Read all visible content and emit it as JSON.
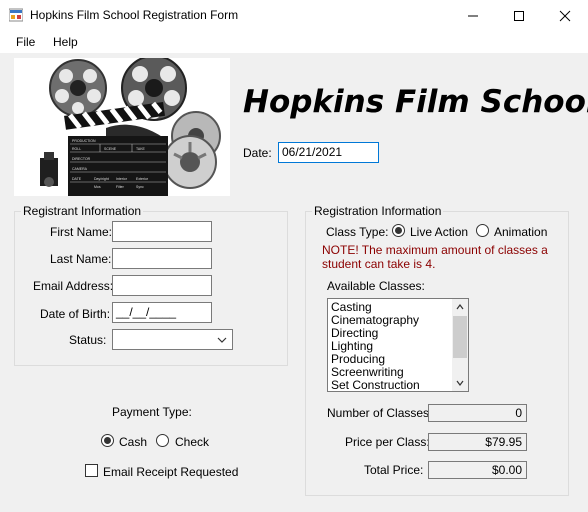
{
  "window": {
    "title": "Hopkins Film School Registration Form"
  },
  "menu": {
    "items": [
      "File",
      "Help"
    ]
  },
  "header": {
    "school_name": "Hopkins Film School",
    "date_label": "Date:",
    "date_value": "06/21/2021"
  },
  "registrant": {
    "group_title": "Registrant Information",
    "first_name_label": "First Name:",
    "last_name_label": "Last Name:",
    "email_label": "Email Address:",
    "dob_label": "Date of Birth:",
    "dob_mask": "__/__/____",
    "status_label": "Status:"
  },
  "payment": {
    "label": "Payment Type:",
    "cash_label": "Cash",
    "check_label": "Check",
    "selected": "Cash",
    "email_receipt_label": "Email Receipt Requested"
  },
  "registration": {
    "group_title": "Registration Information",
    "class_type_label": "Class Type:",
    "live_action_label": "Live Action",
    "animation_label": "Animation",
    "selected_type": "Live Action",
    "note": "NOTE! The maximum amount of classes a student can take is 4.",
    "available_label": "Available Classes:",
    "classes": [
      "Casting",
      "Cinematography",
      "Directing",
      "Lighting",
      "Producing",
      "Screenwriting",
      "Set Construction"
    ],
    "num_classes_label": "Number of Classes:",
    "num_classes_value": "0",
    "price_label": "Price per Class:",
    "price_value": "$79.95",
    "total_label": "Total Price:",
    "total_value": "$0.00"
  },
  "logo": {
    "clapper_rows": [
      "PRODUCTION",
      "ROLL",
      "SCENE",
      "TAKE",
      "DIRECTOR",
      "CAMERA",
      "DATE",
      "Day/night",
      "Interior",
      "Exterior",
      "Mos",
      "Filter",
      "Sync"
    ]
  },
  "colors": {
    "note": "#8b0000",
    "focus_border": "#0078d7"
  }
}
